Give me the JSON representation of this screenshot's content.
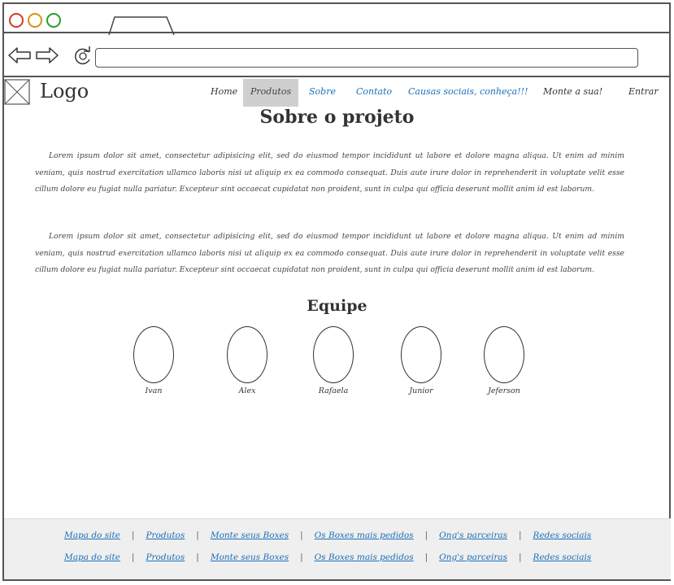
{
  "browser": {
    "url_value": "",
    "colors": {
      "close": "#d23b2a",
      "minimize": "#d89018",
      "maximize": "#2e9a2e"
    }
  },
  "header": {
    "logo_text": "Logo",
    "nav": [
      {
        "label": "Home"
      },
      {
        "label": "Produtos",
        "active": true
      },
      {
        "label": "Sobre"
      },
      {
        "label": "Contato"
      },
      {
        "label": "Causas sociais, conheça!!!"
      },
      {
        "label": "Monte a sua!"
      },
      {
        "label": "Entrar"
      }
    ]
  },
  "main": {
    "title": "Sobre o projeto",
    "paragraphs": [
      "Lorem ipsum dolor sit amet, consectetur adipisicing elit, sed do eiusmod tempor incididunt ut labore et dolore magna aliqua. Ut enim ad minim veniam, quis nostrud exercitation ullamco laboris nisi ut aliquip ex ea commodo consequat. Duis aute irure dolor in reprehenderit in voluptate velit esse cillum dolore eu fugiat nulla pariatur. Excepteur sint occaecat cupidatat non proident, sunt in culpa qui officia deserunt mollit anim id est laborum.",
      "Lorem ipsum dolor sit amet, consectetur adipisicing elit, sed do eiusmod tempor incididunt ut labore et dolore magna aliqua. Ut enim ad minim veniam, quis nostrud exercitation ullamco laboris nisi ut aliquip ex ea commodo consequat. Duis aute irure dolor in reprehenderit in voluptate velit esse cillum dolore eu fugiat nulla pariatur. Excepteur sint occaecat cupidatat non proident, sunt in culpa qui officia deserunt mollit anim id est laborum."
    ],
    "team_title": "Equipe",
    "team": [
      "Ivan",
      "Alex",
      "Rafaela",
      "Junior",
      "Jeferson"
    ]
  },
  "footer": {
    "rows": [
      [
        "Mapa do site",
        "Produtos",
        "Monte seus Boxes",
        "Os Boxes mais pedidos",
        "Ong's parceiras",
        "Redes sociais"
      ],
      [
        "Mapa do site",
        "Produtos",
        "Monte seus Boxes",
        "Os Boxes mais pedidos",
        "Ong's parceiras",
        "Redes sociais"
      ]
    ],
    "separator": "|"
  }
}
